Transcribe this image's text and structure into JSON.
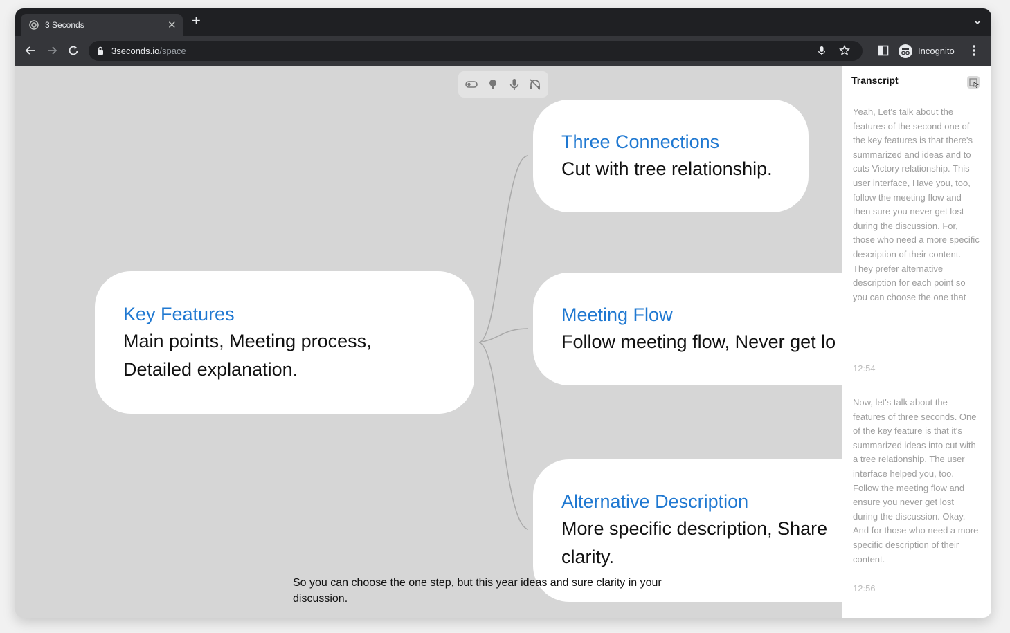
{
  "browser": {
    "tab_title": "3 Seconds",
    "url_host": "3seconds.io",
    "url_path": "/space",
    "profile_label": "Incognito"
  },
  "mindmap": {
    "root": {
      "title": "Key Features",
      "body_line1": "Main points, Meeting process,",
      "body_line2": "Detailed explanation."
    },
    "children": [
      {
        "title": "Three Connections",
        "body_line1": "Cut with tree relationship.",
        "body_line2": ""
      },
      {
        "title": "Meeting Flow",
        "body_line1": "Follow meeting flow, Never get lo",
        "body_line2": ""
      },
      {
        "title": "Alternative Description",
        "body_line1": "More specific description, Share",
        "body_line2": "clarity."
      }
    ]
  },
  "caption": {
    "line1": "So you can choose the one step, but this year ideas and sure clarity in your",
    "line2": "discussion."
  },
  "transcript": {
    "title": "Transcript",
    "entries": [
      {
        "text": "Yeah, Let's talk about the features of the second one of the key features is that there's summarized and ideas and to cuts Victory relationship. This user interface, Have you, too, follow the meeting flow and then sure you never get lost during the discussion. For, those who need a more specific description of their content. They prefer alternative description for each point so you can choose the one that",
        "time": "12:54"
      },
      {
        "text": "Now, let's talk about the features of three seconds. One of the key feature is that it's summarized ideas into cut with a tree relationship. The user interface helped you, too. Follow the meeting flow and ensure you never get lost during the discussion. Okay. And for those who need a more specific description of their content.",
        "time": "12:56"
      }
    ]
  },
  "colors": {
    "accent_blue": "#1f78d1",
    "canvas_bg": "#d6d6d6",
    "chrome_dark": "#35363a"
  }
}
